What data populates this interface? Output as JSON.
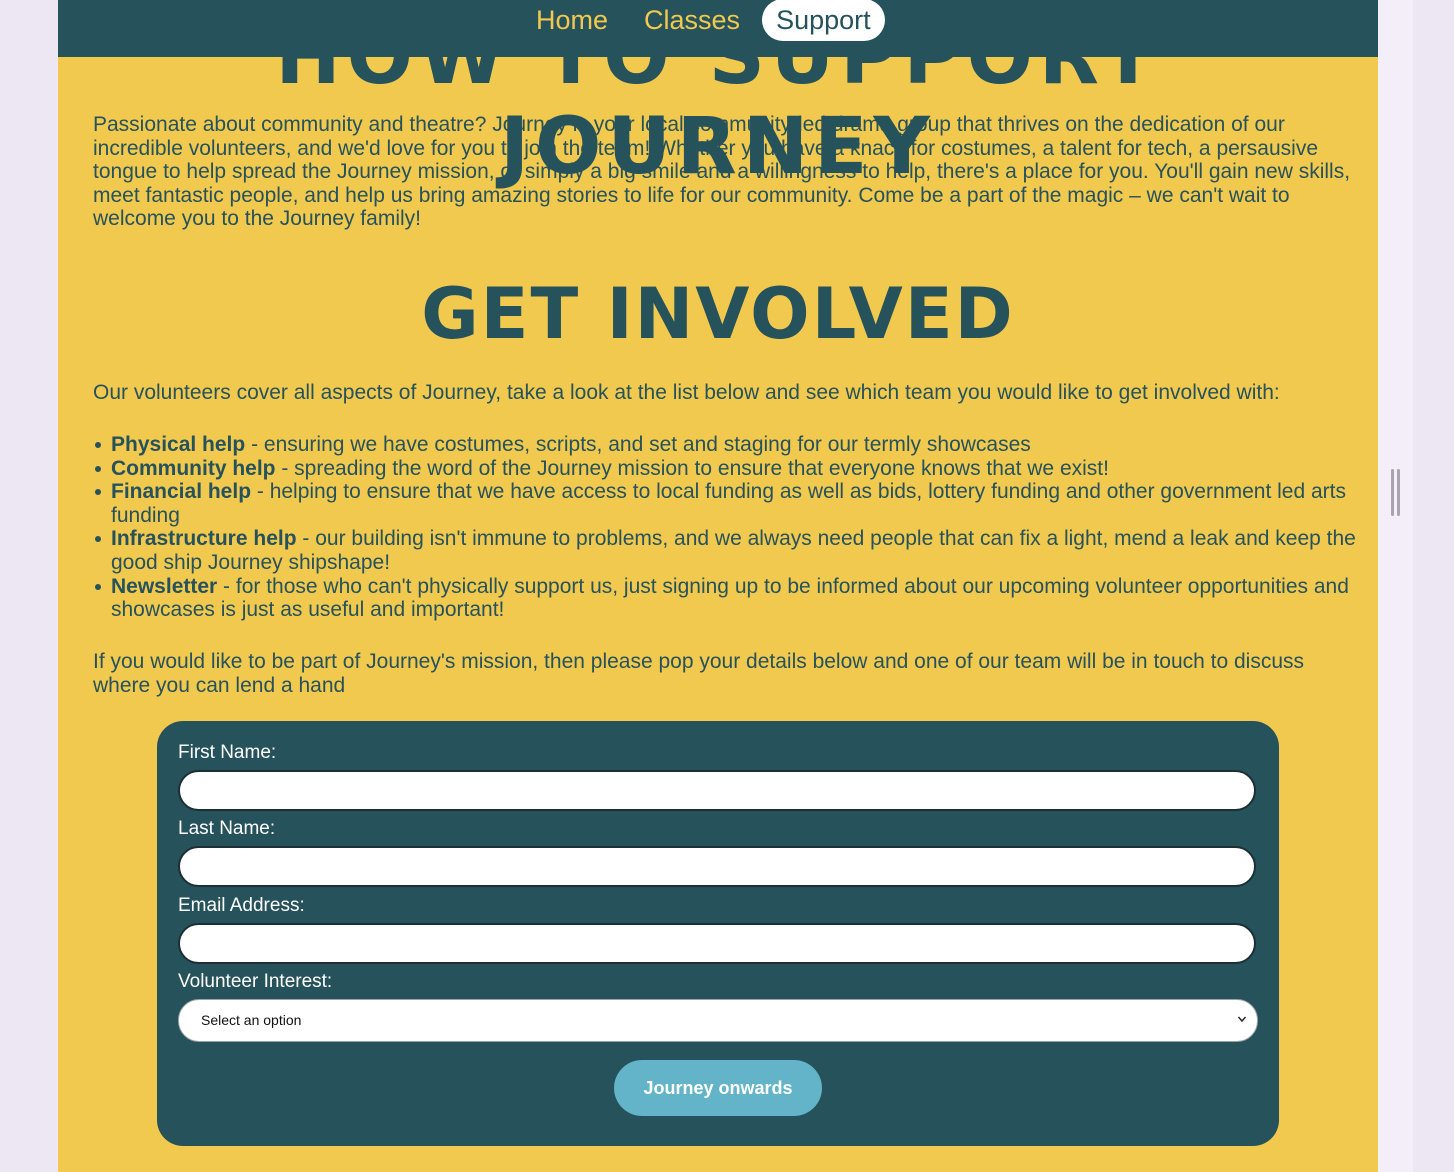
{
  "nav": {
    "items": [
      {
        "label": "Home"
      },
      {
        "label": "Classes"
      },
      {
        "label": "Support"
      }
    ],
    "active": "Support"
  },
  "hero": {
    "title": "HOW TO SUPPORT JOURNEY"
  },
  "intro": {
    "text": "Passionate about community and theatre? Journey is your local community-led drama group that thrives on the dedication of our incredible volunteers, and we'd love for you to join the team! Whether you have a knack for costumes, a talent for tech, a persausive tongue to help spread the Journey mission, or simply a big smile and a willingness to help, there's a place for you. You'll gain new skills, meet fantastic people, and help us bring amazing stories to life for our community. Come be a part of the magic – we can't wait to welcome you to the Journey family!"
  },
  "get_involved": {
    "title": "GET INVOLVED",
    "lead": "Our volunteers cover all aspects of Journey, take a look at the list below and see which team you would like to get involved with:",
    "teams": [
      {
        "name": "Physical help",
        "description": " - ensuring we have costumes, scripts, and set and staging for our termly showcases"
      },
      {
        "name": "Community help",
        "description": " - spreading the word of the Journey mission to ensure that everyone knows that we exist!"
      },
      {
        "name": "Financial help",
        "description": " - helping to ensure that we have access to local funding as well as bids, lottery funding and other government led arts funding"
      },
      {
        "name": "Infrastructure help",
        "description": " - our building isn't immune to problems, and we always need people that can fix a light, mend a leak and keep the good ship Journey shipshape!"
      },
      {
        "name": "Newsletter",
        "description": " - for those who can't physically support us, just signing up to be informed about our upcoming volunteer opportunities and showcases is just as useful and important!"
      }
    ],
    "closing": "If you would like to be part of Journey's mission, then please pop your details below and one of our team will be in touch to discuss where you can lend a hand"
  },
  "form": {
    "first_name_label": "First Name:",
    "first_name_value": "",
    "last_name_label": "Last Name:",
    "last_name_value": "",
    "email_label": "Email Address:",
    "email_value": "",
    "interest_label": "Volunteer Interest:",
    "interest_selected": "Select an option",
    "submit_label": "Journey onwards"
  },
  "colors": {
    "page_background": "#f2c94f",
    "navbar": "#26525c",
    "text": "#26525c",
    "nav_link": "#f2c94f",
    "button": "#63b4c8"
  }
}
